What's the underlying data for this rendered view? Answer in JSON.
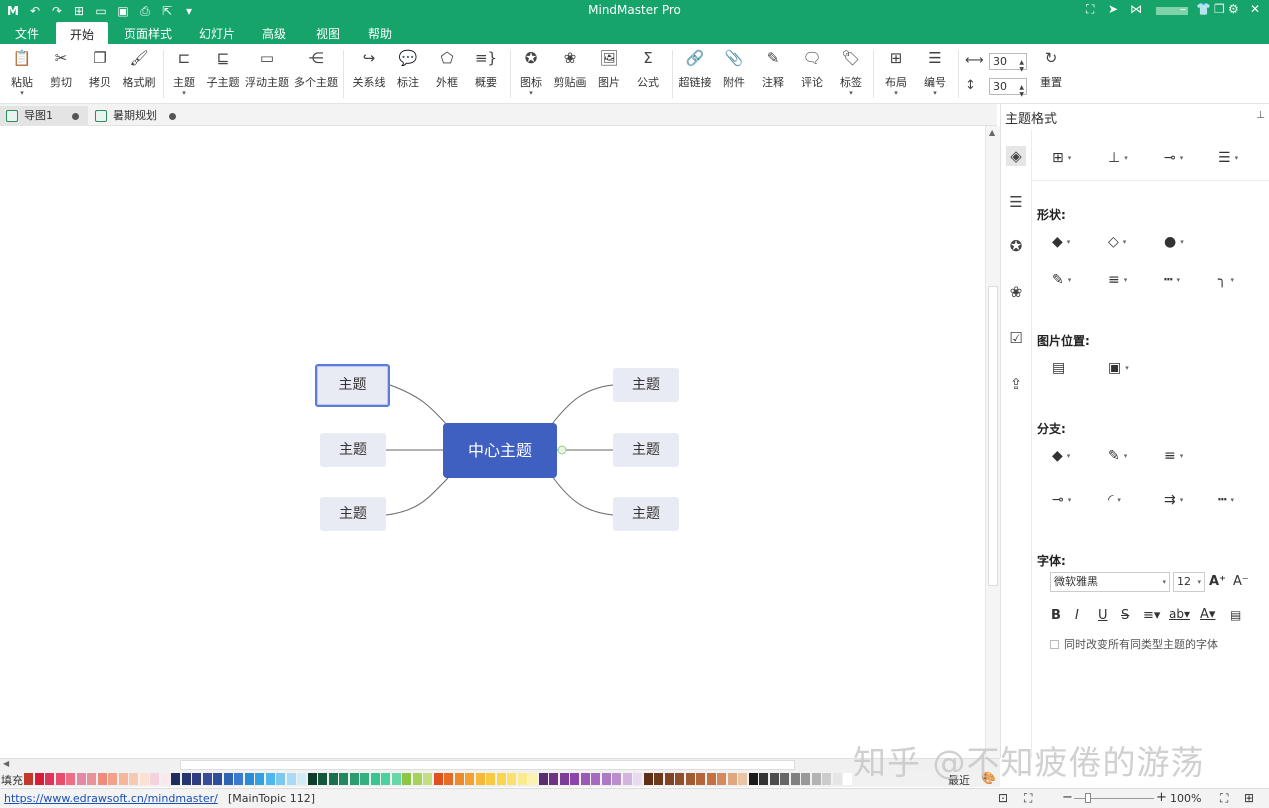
{
  "app": {
    "title": "MindMaster Pro"
  },
  "menu": {
    "items": [
      "文件",
      "开始",
      "页面样式",
      "幻灯片",
      "高级",
      "视图",
      "帮助"
    ],
    "active": "开始"
  },
  "ribbon": {
    "clipboard": [
      "粘贴",
      "剪切",
      "拷贝",
      "格式刷"
    ],
    "topics": [
      "主题",
      "子主题",
      "浮动主题",
      "多个主题"
    ],
    "relations": [
      "关系线",
      "标注",
      "外框",
      "概要"
    ],
    "insert": [
      "图标",
      "剪贴画",
      "图片",
      "公式"
    ],
    "attach": [
      "超链接",
      "附件",
      "注释",
      "评论",
      "标签"
    ],
    "layout": [
      "布局",
      "编号"
    ],
    "spacing": {
      "h": "30",
      "v": "30"
    },
    "reset": "重置"
  },
  "tabs": [
    {
      "label": "导图1"
    },
    {
      "label": "暑期规划"
    }
  ],
  "mindmap": {
    "center": "中心主题",
    "left": [
      "主题",
      "主题",
      "主题"
    ],
    "right": [
      "主题",
      "主题",
      "主题"
    ]
  },
  "sidebar": {
    "title": "主题格式",
    "shape_label": "形状:",
    "image_pos_label": "图片位置:",
    "branch_label": "分支:",
    "font_label": "字体:",
    "font_name": "微软雅黑",
    "font_size": "12",
    "checkbox_label": "同时改变所有同类型主题的字体"
  },
  "palette": {
    "fill_label": "填充",
    "recent_label": "最近",
    "colors": [
      "#c0392b",
      "#d81b3b",
      "#e0345a",
      "#ea4d6b",
      "#ef6e85",
      "#e388a6",
      "#e6949a",
      "#f08a7a",
      "#f3a28a",
      "#f6b69a",
      "#f8c9b2",
      "#fde0d4",
      "#f6d2de",
      "#fbe8ef",
      "#1d2d5c",
      "#25356e",
      "#2d3d80",
      "#3a4d99",
      "#2d4f9a",
      "#2f64b4",
      "#3a7bd0",
      "#2b8bd6",
      "#35a0e0",
      "#4db6ec",
      "#7cc9f0",
      "#a8dcf6",
      "#d2ecfa",
      "#103c2c",
      "#14573d",
      "#1b6e4f",
      "#24875f",
      "#2b9c6f",
      "#32b07f",
      "#39c58f",
      "#4bd09e",
      "#67d6a9",
      "#8ec63f",
      "#a6d15a",
      "#c2de7e",
      "#e0501f",
      "#e86b25",
      "#ef8a2c",
      "#f2a232",
      "#f5b839",
      "#f8ca40",
      "#fad64c",
      "#fbe16b",
      "#fceb8d",
      "#fdf2b3",
      "#5b2c6f",
      "#6c3483",
      "#7d3c98",
      "#8e44ad",
      "#9b59b6",
      "#a569bd",
      "#af7ac5",
      "#bb8fce",
      "#d2b4de",
      "#e8daef",
      "#5d2f17",
      "#6e3a1e",
      "#7f4525",
      "#90502c",
      "#a15b33",
      "#b2663a",
      "#c37141",
      "#d38a5c",
      "#e0a77f",
      "#eac4a6",
      "#1a1a1a",
      "#333333",
      "#4d4d4d",
      "#666666",
      "#808080",
      "#999999",
      "#b3b3b3",
      "#cccccc",
      "#e6e6e6",
      "#ffffff"
    ]
  },
  "status": {
    "url": "https://www.edrawsoft.cn/mindmaster/",
    "info": "[MainTopic 112]",
    "zoom": "100%"
  },
  "watermark": "知乎 @不知疲倦的游荡",
  "colors": {
    "brand": "#16a46b",
    "center_topic": "#3f5fc1",
    "topic_bg": "#e8ebf3",
    "selection": "#5d7bd8"
  }
}
